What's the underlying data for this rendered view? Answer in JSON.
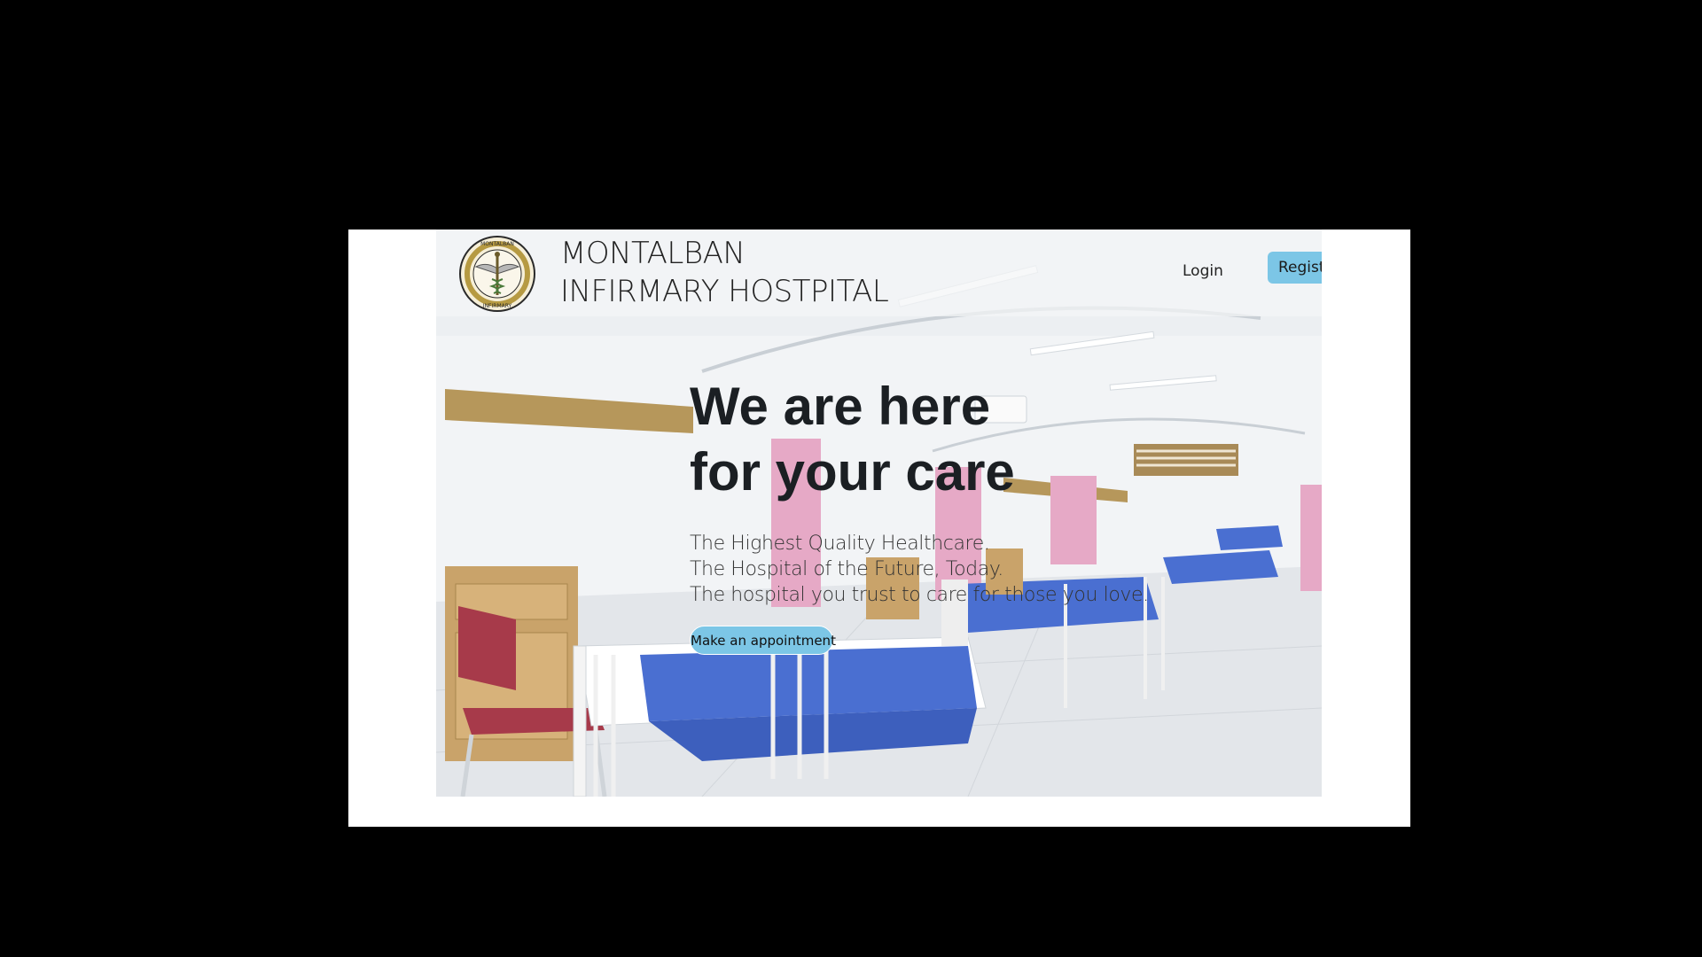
{
  "brand": {
    "logo_text_top": "MONTALBAN",
    "logo_text_bottom": "INFIRMARY",
    "name_line1": "MONTALBAN",
    "name_line2": "INFIRMARY HOSTPITAL"
  },
  "nav": {
    "login_label": "Login",
    "register_label": "Register"
  },
  "hero": {
    "headline_line1": "We are here",
    "headline_line2": "for your care",
    "taglines": [
      "The Highest Quality Healthcare.",
      "The Hospital of the Future, Today.",
      "The hospital you trust to care for those you love."
    ],
    "cta_label": "Make an appointment",
    "background_icon": "hospital-ward-photo"
  },
  "colors": {
    "accent": "#7cc6e6",
    "page_background": "#000000",
    "slide_background": "#ffffff",
    "headline": "#1b1f23",
    "bed_blanket": "#4a6fd1",
    "curtain": "#e6a9c6"
  }
}
